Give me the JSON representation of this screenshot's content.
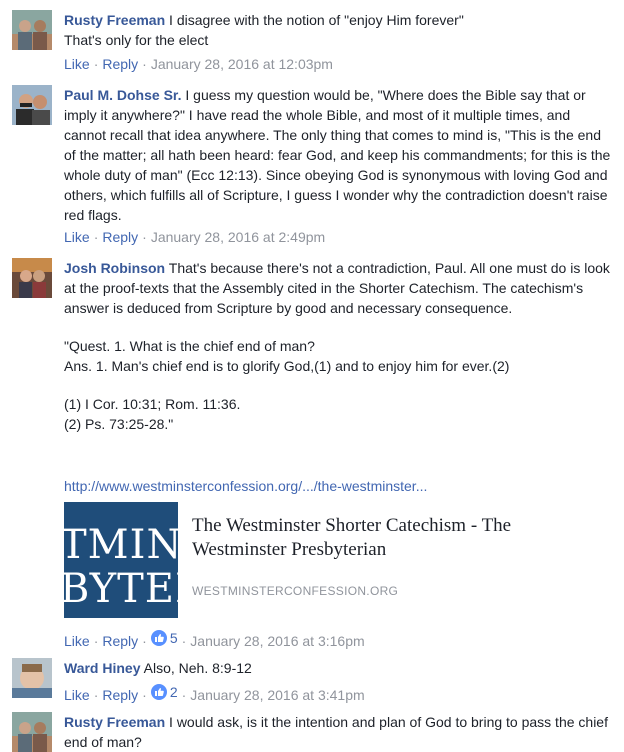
{
  "colors": {
    "link": "#4267b2",
    "name": "#385898",
    "muted": "#90949c",
    "like": "#5890ff"
  },
  "actions_labels": {
    "like": "Like",
    "reply": "Reply"
  },
  "comments": [
    {
      "author": "Rusty Freeman",
      "lines": [
        "I disagree with the notion of \"enjoy Him forever\"",
        "That's only for the elect"
      ],
      "timestamp": "January 28, 2016 at 12:03pm"
    },
    {
      "author": "Paul M. Dohse Sr.",
      "text": "I guess my question would be, \"Where does the Bible say that or imply it anywhere?\" I have read the whole Bible, and most of it multiple times, and cannot recall that idea anywhere. The only thing that comes to mind is, \"This is the end of the matter; all hath been heard: fear God, and keep his commandments; for this is the whole duty of man\" (Ecc 12:13). Since obeying God is synonymous with loving God and others, which fulfills all of Scripture, I guess I wonder why the contradiction doesn't raise red flags.",
      "timestamp": "January 28, 2016 at 2:49pm"
    },
    {
      "author": "Josh Robinson",
      "text": "That's because there's not a contradiction, Paul. All one must do is look at the proof-texts that the Assembly cited in the Shorter Catechism. The catechism's answer is deduced from Scripture by good and necessary consequence.",
      "quote_lines": [
        "\"Quest. 1. What is the chief end of man?",
        "Ans. 1. Man's chief end is to glorify God,(1) and to enjoy him for ever.(2)"
      ],
      "refs": [
        "(1) I Cor. 10:31; Rom. 11:36.",
        "(2) Ps. 73:25-28.\""
      ],
      "url": "http://www.westminsterconfession.org/.../the-westminster...",
      "card": {
        "thumb_line1": "TMIN",
        "thumb_line2": "BYTEI",
        "title": "The Westminster Shorter Catechism - The Westminster Presbyterian",
        "domain": "WESTMINSTERCONFESSION.ORG"
      },
      "likes": "5",
      "timestamp": "January 28, 2016 at 3:16pm"
    },
    {
      "author": "Ward Hiney",
      "text": "Also, Neh. 8:9-12",
      "likes": "2",
      "timestamp": "January 28, 2016 at 3:41pm"
    },
    {
      "author": "Rusty Freeman",
      "text": "I would ask, is it the intention and plan of God to bring to pass the chief end of man?"
    }
  ]
}
